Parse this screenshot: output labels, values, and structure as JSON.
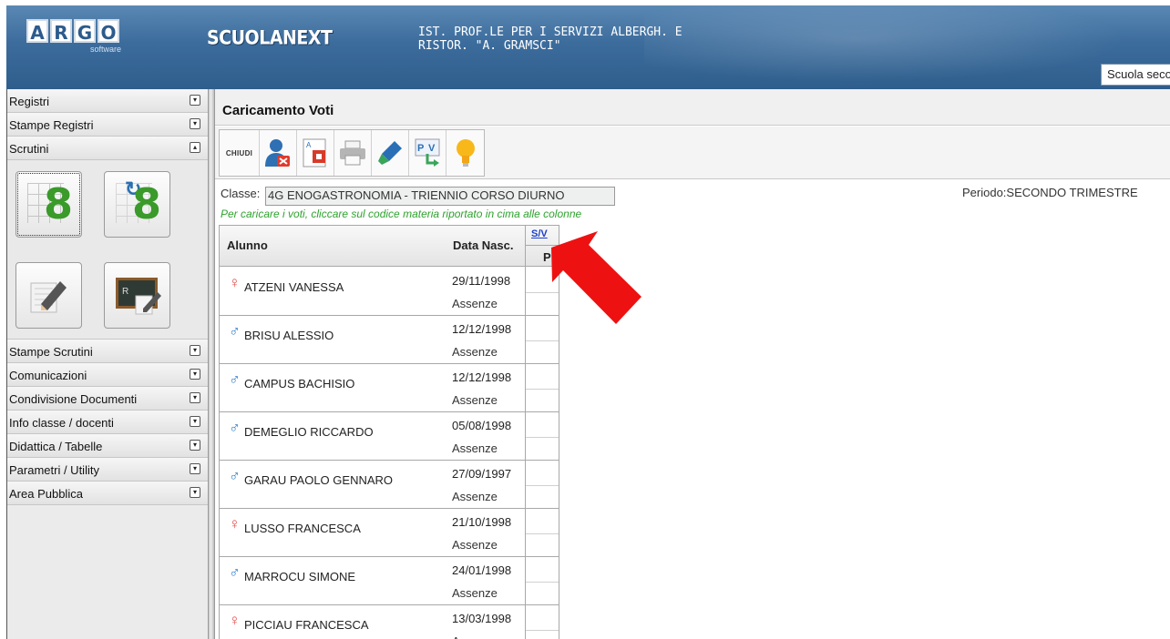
{
  "header": {
    "logo_letters": [
      "A",
      "R",
      "G",
      "O"
    ],
    "logo_sub": "software",
    "brand": "SCUOLANEXT",
    "school_line1": "IST. PROF.LE PER I SERVIZI ALBERGH. E",
    "school_line2": "RISTOR. \"A. GRAMSCI\"",
    "school_select_value": "Scuola seco"
  },
  "sidebar": {
    "top_items": [
      {
        "label": "Registri",
        "toggle": "▾"
      },
      {
        "label": "Stampe Registri",
        "toggle": "▾"
      },
      {
        "label": "Scrutini",
        "toggle": "▴"
      }
    ],
    "bottom_items": [
      {
        "label": "Stampe Scrutini",
        "toggle": "▾"
      },
      {
        "label": "Comunicazioni",
        "toggle": "▾"
      },
      {
        "label": "Condivisione Documenti",
        "toggle": "▾"
      },
      {
        "label": "Info classe / docenti",
        "toggle": "▾"
      },
      {
        "label": "Didattica / Tabelle",
        "toggle": "▾"
      },
      {
        "label": "Parametri / Utility",
        "toggle": "▾"
      },
      {
        "label": "Area Pubblica",
        "toggle": "▾"
      }
    ],
    "scrutini_buttons": [
      "8",
      "8"
    ]
  },
  "main": {
    "title": "Caricamento Voti",
    "toolbar": {
      "close_label": "CHIUDI",
      "icons": [
        "user-remove-icon",
        "report-card-icon",
        "printer-icon",
        "marker-icon",
        "pv-export-icon",
        "lightbulb-icon"
      ]
    },
    "classe_label": "Classe:",
    "classe_value": "4G ENOGASTRONOMIA - TRIENNIO CORSO DIURNO",
    "periodo": "Periodo:SECONDO TRIMESTRE",
    "hint": "Per caricare i voti, cliccare sul codice materia riportato in cima alle colonne",
    "table": {
      "col_alunno": "Alunno",
      "col_data": "Data Nasc.",
      "col_subject": "S/V",
      "col_sub": "P",
      "absence_label": "Assenze",
      "rows": [
        {
          "gender": "F",
          "symbol": "♀",
          "name": "ATZENI VANESSA",
          "date": "29/11/1998"
        },
        {
          "gender": "M",
          "symbol": "♂",
          "name": "BRISU ALESSIO",
          "date": "12/12/1998"
        },
        {
          "gender": "M",
          "symbol": "♂",
          "name": "CAMPUS BACHISIO",
          "date": "12/12/1998"
        },
        {
          "gender": "M",
          "symbol": "♂",
          "name": "DEMEGLIO RICCARDO",
          "date": "05/08/1998"
        },
        {
          "gender": "M",
          "symbol": "♂",
          "name": "GARAU PAOLO GENNARO",
          "date": "27/09/1997"
        },
        {
          "gender": "F",
          "symbol": "♀",
          "name": "LUSSO FRANCESCA",
          "date": "21/10/1998"
        },
        {
          "gender": "M",
          "symbol": "♂",
          "name": "MARROCU SIMONE",
          "date": "24/01/1998"
        },
        {
          "gender": "F",
          "symbol": "♀",
          "name": "PICCIAU FRANCESCA",
          "date": "13/03/1998"
        }
      ]
    }
  },
  "colors": {
    "header_blue": "#3c6c9c",
    "hint_green": "#2fa22f",
    "link_blue": "#1c3ec9",
    "arrow_red": "#ee1111",
    "female": "#e44c4c",
    "male": "#2f7ec8"
  }
}
